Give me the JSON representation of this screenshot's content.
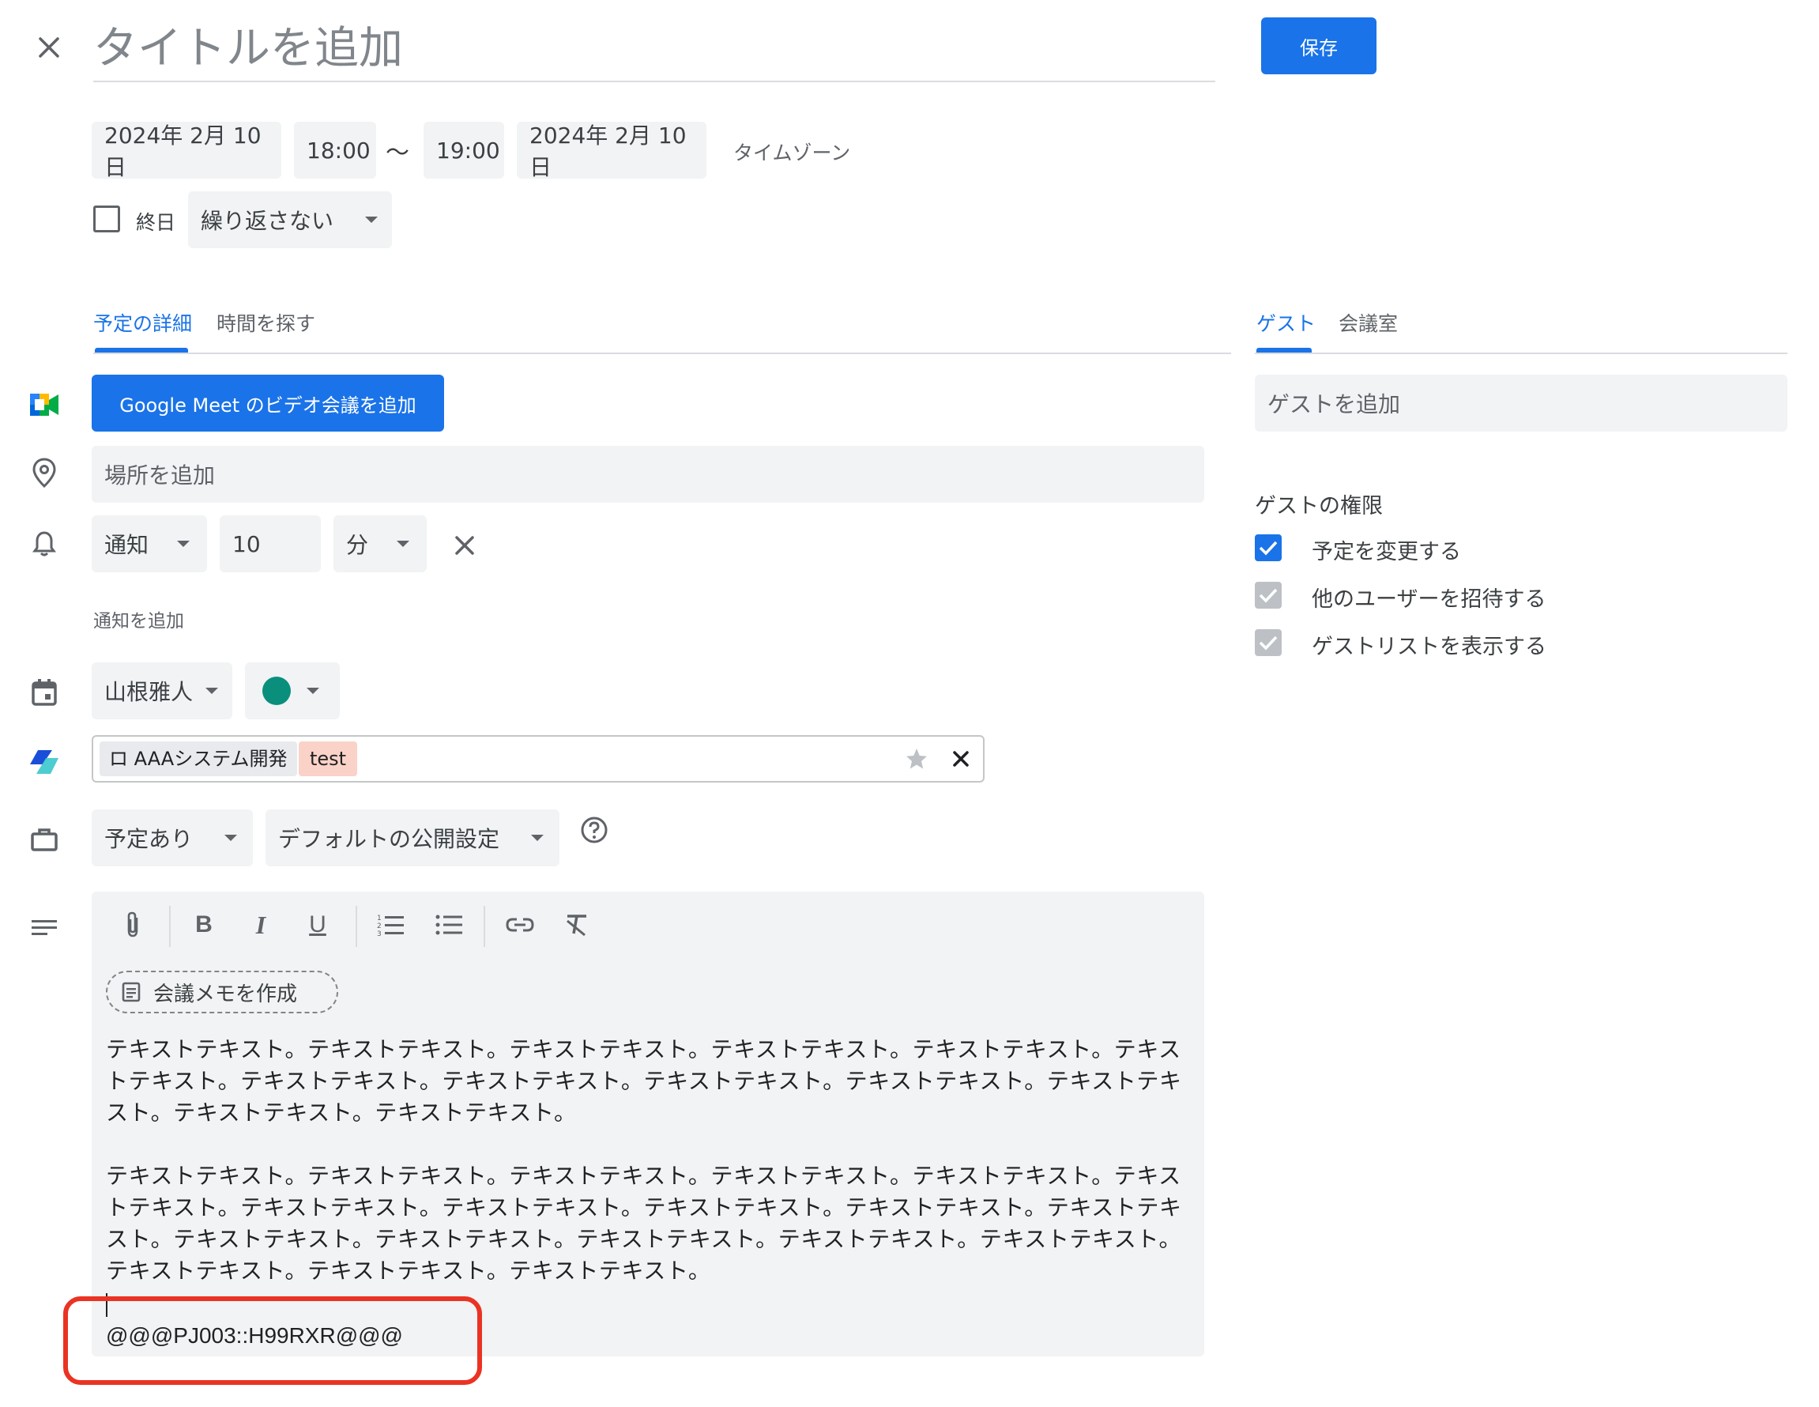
{
  "header": {
    "close_label": "×",
    "title_placeholder": "タイトルを追加",
    "save_label": "保存"
  },
  "datetime": {
    "start_date": "2024年 2月 10日",
    "start_time": "18:00",
    "separator": "〜",
    "end_time": "19:00",
    "end_date": "2024年 2月 10日",
    "timezone": "タイムゾーン",
    "all_day_label": "終日",
    "repeat": "繰り返さない"
  },
  "tabs": {
    "details": "予定の詳細",
    "find_time": "時間を探す",
    "guests": "ゲスト",
    "rooms": "会議室"
  },
  "meet_button": "Google Meet のビデオ会議を追加",
  "location_placeholder": "場所を追加",
  "notification": {
    "type": "通知",
    "value": "10",
    "unit": "分",
    "add_label": "通知を追加"
  },
  "calendar": {
    "owner": "山根雅人",
    "color": "#0b8043"
  },
  "tags": {
    "project_tag": "ロ AAAシステム開発",
    "test_tag": "test"
  },
  "availability": {
    "status": "予定あり",
    "visibility": "デフォルトの公開設定"
  },
  "description": {
    "meeting_notes_label": "会議メモを作成",
    "paragraph1": "テキストテキスト。テキストテキスト。テキストテキスト。テキストテキスト。テキストテキスト。テキストテキスト。テキストテキスト。テキストテキスト。テキストテキスト。テキストテキスト。テキストテキスト。テキストテキスト。テキストテキスト。",
    "paragraph2": "テキストテキスト。テキストテキスト。テキストテキスト。テキストテキスト。テキストテキスト。テキストテキスト。テキストテキスト。テキストテキスト。テキストテキスト。テキストテキスト。テキストテキスト。テキストテキスト。テキストテキスト。テキストテキスト。テキストテキスト。テキストテキスト。テキストテキスト。テキストテキスト。テキストテキスト。",
    "code": "@@@PJ003::H99RXR@@@"
  },
  "guests": {
    "add_placeholder": "ゲストを追加",
    "permissions_title": "ゲストの権限",
    "permissions": [
      {
        "label": "予定を変更する",
        "checked": true
      },
      {
        "label": "他のユーザーを招待する",
        "checked": true
      },
      {
        "label": "ゲストリストを表示する",
        "checked": true
      }
    ]
  },
  "colors": {
    "accent": "#1a73e8",
    "highlight_box": "#ea3323",
    "tag_test_bg": "#fad2c8"
  }
}
